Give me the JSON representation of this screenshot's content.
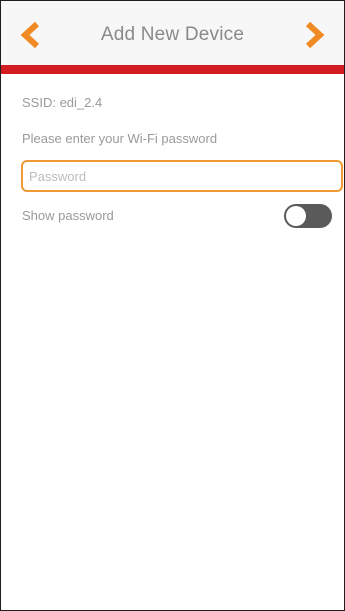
{
  "header": {
    "title": "Add New Device",
    "back_icon": "chevron-left-icon",
    "next_icon": "chevron-right-icon",
    "accent_color": "#f08a24",
    "bar_color": "#d31c22"
  },
  "form": {
    "ssid_text": "SSID: edi_2.4",
    "prompt": "Please enter your Wi-Fi password",
    "password_placeholder": "Password",
    "password_value": "",
    "show_password_label": "Show password",
    "show_password_on": false
  }
}
